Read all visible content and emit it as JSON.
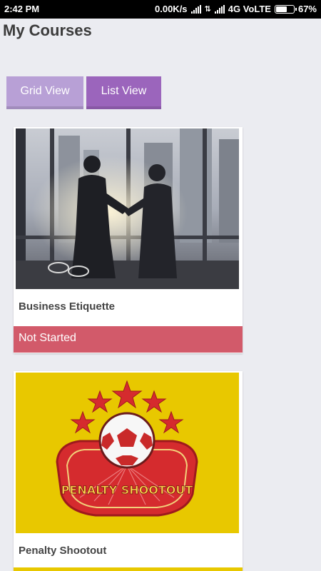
{
  "status_bar": {
    "time": "2:42 PM",
    "speed": "0.00K/s",
    "network": "4G VoLTE",
    "battery": "67%",
    "battery_level": 0.67
  },
  "page": {
    "title": "My Courses"
  },
  "view_toggle": {
    "grid_label": "Grid View",
    "list_label": "List View"
  },
  "courses": [
    {
      "title": "Business Etiquette",
      "status": "Not Started",
      "status_color": "#d25a6a",
      "image": "handshake-silhouette-photo"
    },
    {
      "title": "Penalty Shootout",
      "image": "penalty-shootout-logo",
      "logo_text": "PENALTY SHOOTOUT"
    }
  ],
  "colors": {
    "grid_button": "#b8a0d6",
    "list_button": "#9b65bc",
    "background": "#ebecf1"
  }
}
